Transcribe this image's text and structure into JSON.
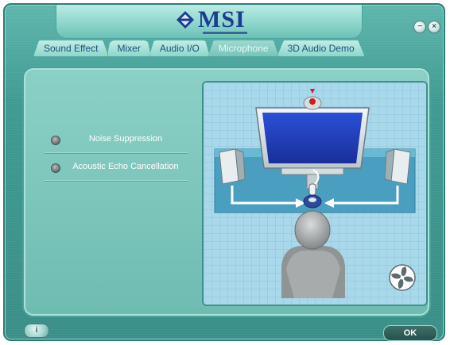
{
  "app": {
    "brand": "MSI",
    "window_buttons": {
      "minimize": "−",
      "close": "×"
    }
  },
  "tabs": [
    {
      "label": "Sound Effect",
      "active": false
    },
    {
      "label": "Mixer",
      "active": false
    },
    {
      "label": "Audio I/O",
      "active": false
    },
    {
      "label": "Microphone",
      "active": true
    },
    {
      "label": "3D Audio Demo",
      "active": false
    }
  ],
  "options": [
    {
      "label": "Noise Suppression",
      "selected": false
    },
    {
      "label": "Acoustic Echo Cancellation",
      "selected": false
    }
  ],
  "footer": {
    "info_label": "i",
    "ok_label": "OK"
  },
  "colors": {
    "accent": "#3a8f88",
    "brand_blue": "#1c3d8f",
    "screen_blue": "#1e3fbf",
    "grid_bg": "#a9d8ea"
  },
  "icons": {
    "logo": "msi-dragon-icon",
    "camera": "webcam-icon",
    "speaker": "speaker-icon",
    "microphone": "microphone-icon",
    "fan": "fan-icon",
    "info": "info-icon"
  }
}
